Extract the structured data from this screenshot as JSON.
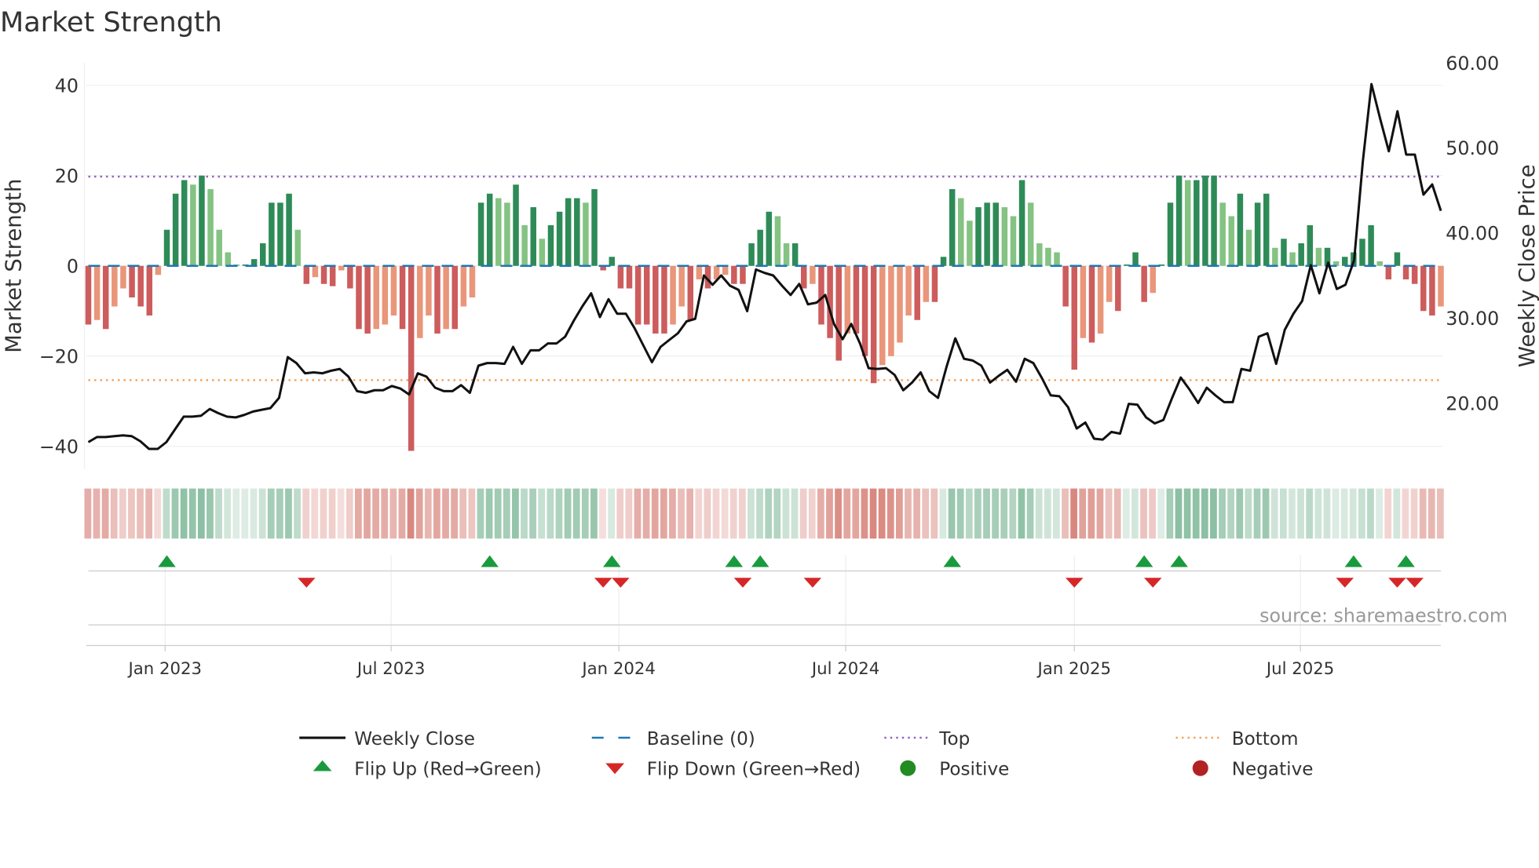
{
  "chart_data": {
    "type": "bar",
    "title": "Market Strength",
    "ylabel": "Market Strength",
    "y2label": "Weekly Close Price",
    "ylim": [
      -45,
      45
    ],
    "y2lim": [
      12.25,
      60
    ],
    "yticks": [
      "40",
      "20",
      "0",
      "−20",
      "−40"
    ],
    "ytick_values": [
      40,
      20,
      0,
      -20,
      -40
    ],
    "y2ticks": [
      "60.00",
      "50.00",
      "40.00",
      "30.00",
      "20.00"
    ],
    "y2tick_values": [
      60,
      50,
      40,
      30,
      20
    ],
    "x_unit": "week index",
    "xticks": [
      {
        "label": "Jan 2023",
        "week": 8.8
      },
      {
        "label": "Jul 2023",
        "week": 34.7
      },
      {
        "label": "Jan 2024",
        "week": 60.8
      },
      {
        "label": "Jul 2024",
        "week": 86.8
      },
      {
        "label": "Jan 2025",
        "week": 113
      },
      {
        "label": "Jul 2025",
        "week": 138.9
      }
    ],
    "thresholds": {
      "top": 20,
      "bottom": -25,
      "baseline": 0
    },
    "strength": [
      -13,
      -12,
      -14,
      -9,
      -5,
      -7,
      -9,
      -11,
      -2,
      8,
      16,
      19,
      18,
      20,
      17,
      8,
      3,
      0.3,
      0.3,
      1.5,
      5,
      14,
      14,
      16,
      8,
      -4,
      -2.5,
      -4,
      -4.5,
      -1,
      -5,
      -14,
      -15,
      -14,
      -13,
      -11,
      -14,
      -41,
      -16,
      -11,
      -15,
      -14,
      -14,
      -9,
      -7,
      14,
      16,
      15,
      14,
      18,
      9,
      13,
      6,
      9,
      12,
      15,
      15,
      14,
      17,
      -1,
      2,
      -5,
      -5,
      -13,
      -13,
      -15,
      -15,
      -13,
      -9,
      -12,
      -3,
      -5,
      -3,
      -2,
      -4,
      -4,
      5,
      8,
      12,
      11,
      5,
      5,
      -5,
      -4,
      -13,
      -16,
      -21,
      -15,
      -15,
      -20,
      -26,
      -22,
      -20,
      -17,
      -11,
      -12,
      -8,
      -8,
      2,
      17,
      15,
      10,
      13,
      14,
      14,
      13,
      11,
      19,
      14,
      5,
      4,
      3,
      -9,
      -23,
      -16,
      -17,
      -15,
      -8,
      -10,
      0.3,
      3,
      -8,
      -6,
      0.3,
      14,
      20,
      19,
      19,
      20,
      20,
      14,
      11,
      16,
      8,
      14,
      16,
      4,
      6,
      3,
      5,
      9,
      4,
      4,
      1,
      2,
      3,
      6,
      9,
      1,
      -3,
      3,
      -3,
      -4,
      -10,
      -11,
      -9
    ],
    "weekly_close": [
      15.4,
      16.0,
      16.0,
      16.1,
      16.2,
      16.1,
      15.5,
      14.6,
      14.6,
      15.4,
      16.9,
      18.4,
      18.4,
      18.5,
      19.3,
      18.8,
      18.4,
      18.3,
      18.6,
      19.0,
      19.2,
      19.4,
      20.6,
      25.4,
      24.7,
      23.5,
      23.6,
      23.5,
      23.8,
      24.0,
      23.1,
      21.4,
      21.2,
      21.5,
      21.5,
      22.0,
      21.7,
      21.0,
      23.5,
      23.1,
      21.8,
      21.4,
      21.4,
      22.1,
      21.2,
      24.4,
      24.7,
      24.7,
      24.6,
      26.6,
      24.6,
      26.2,
      26.2,
      27.0,
      27.0,
      27.8,
      29.7,
      31.4,
      32.9,
      30.1,
      32.2,
      30.5,
      30.5,
      28.8,
      26.8,
      24.8,
      26.6,
      27.4,
      28.2,
      29.6,
      29.9,
      35.0,
      33.9,
      35.0,
      33.8,
      33.3,
      30.8,
      35.7,
      35.3,
      35.0,
      33.8,
      32.7,
      34.0,
      31.6,
      31.8,
      32.7,
      29.3,
      27.5,
      29.3,
      27.0,
      24.1,
      24.0,
      24.1,
      23.3,
      21.5,
      22.4,
      23.6,
      21.4,
      20.6,
      24.3,
      27.6,
      25.2,
      25.0,
      24.4,
      22.4,
      23.2,
      23.9,
      22.5,
      25.2,
      24.7,
      22.9,
      20.9,
      20.8,
      19.5,
      17.0,
      17.7,
      15.8,
      15.7,
      16.6,
      16.4,
      19.9,
      19.8,
      18.3,
      17.6,
      18.0,
      20.6,
      23.0,
      21.6,
      20.0,
      21.8,
      20.9,
      20.1,
      20.1,
      24.0,
      23.8,
      27.8,
      28.2,
      24.6,
      28.6,
      30.5,
      32.0,
      36.2,
      32.9,
      36.5,
      33.4,
      33.9,
      36.8,
      48.4,
      57.5,
      53.4,
      49.6,
      54.3,
      49.2,
      49.2,
      44.5,
      45.7,
      42.6
    ],
    "flip_up_weeks": [
      9,
      46,
      60,
      74,
      77,
      99,
      121,
      125,
      145,
      151
    ],
    "flip_down_weeks": [
      25,
      59,
      61,
      75,
      83,
      113,
      122,
      144,
      150,
      152
    ],
    "legend": {
      "placement": "bottom",
      "items": [
        {
          "label": "Weekly Close",
          "kind": "line"
        },
        {
          "label": "Baseline (0)",
          "kind": "dashed"
        },
        {
          "label": "Top",
          "kind": "dotted-top"
        },
        {
          "label": "Bottom",
          "kind": "dotted-bottom"
        },
        {
          "label": "Flip Up (Red→Green)",
          "kind": "tri-up"
        },
        {
          "label": "Flip Down (Green→Red)",
          "kind": "tri-down"
        },
        {
          "label": "Positive",
          "kind": "dot-pos"
        },
        {
          "label": "Negative",
          "kind": "dot-neg"
        }
      ]
    },
    "source": "source: sharemaestro.com",
    "colors": {
      "pos_dark": "#2e8b57",
      "pos_light": "#84c382",
      "neg_dark": "#cd5c5c",
      "neg_light": "#e9967a",
      "baseline": "#1f77b4",
      "top": "#9467bd",
      "bottom": "#f4a460",
      "line": "#111111",
      "up": "#1a9a3e",
      "down": "#d62728",
      "positive": "#228b22",
      "negative": "#b22222"
    }
  }
}
